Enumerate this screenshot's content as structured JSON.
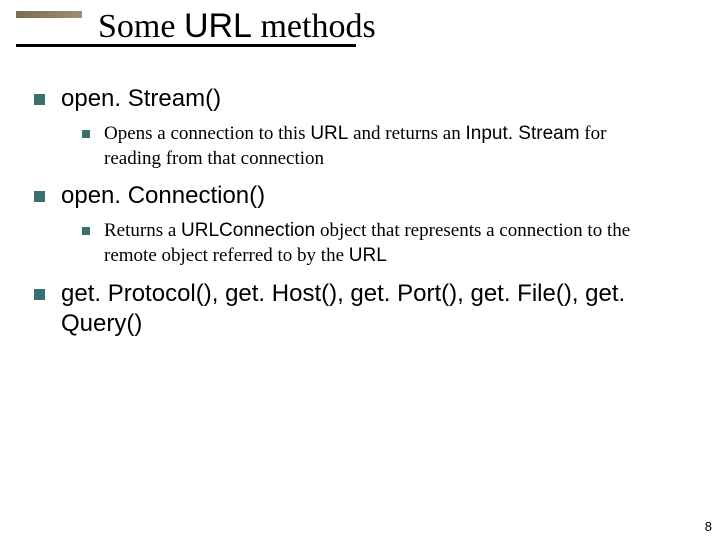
{
  "title": {
    "pre": "Some ",
    "api": "URL",
    "post": " methods"
  },
  "items": [
    {
      "label_api": "open. Stream()",
      "sub": {
        "pre": "Opens a connection to this ",
        "api": "URL",
        "mid": " and returns an ",
        "api2": "Input. Stream",
        "post": " for reading from that connection"
      }
    },
    {
      "label_api": "open. Connection()",
      "sub": {
        "pre": "Returns a ",
        "api": "URLConnection",
        "mid": " object that represents a connection to the remote object referred to by the ",
        "api2": "URL",
        "post": ""
      }
    },
    {
      "label_api": "get. Protocol(), get. Host(), get. Port(), get. File(), get. Query()"
    }
  ],
  "page_number": "8"
}
